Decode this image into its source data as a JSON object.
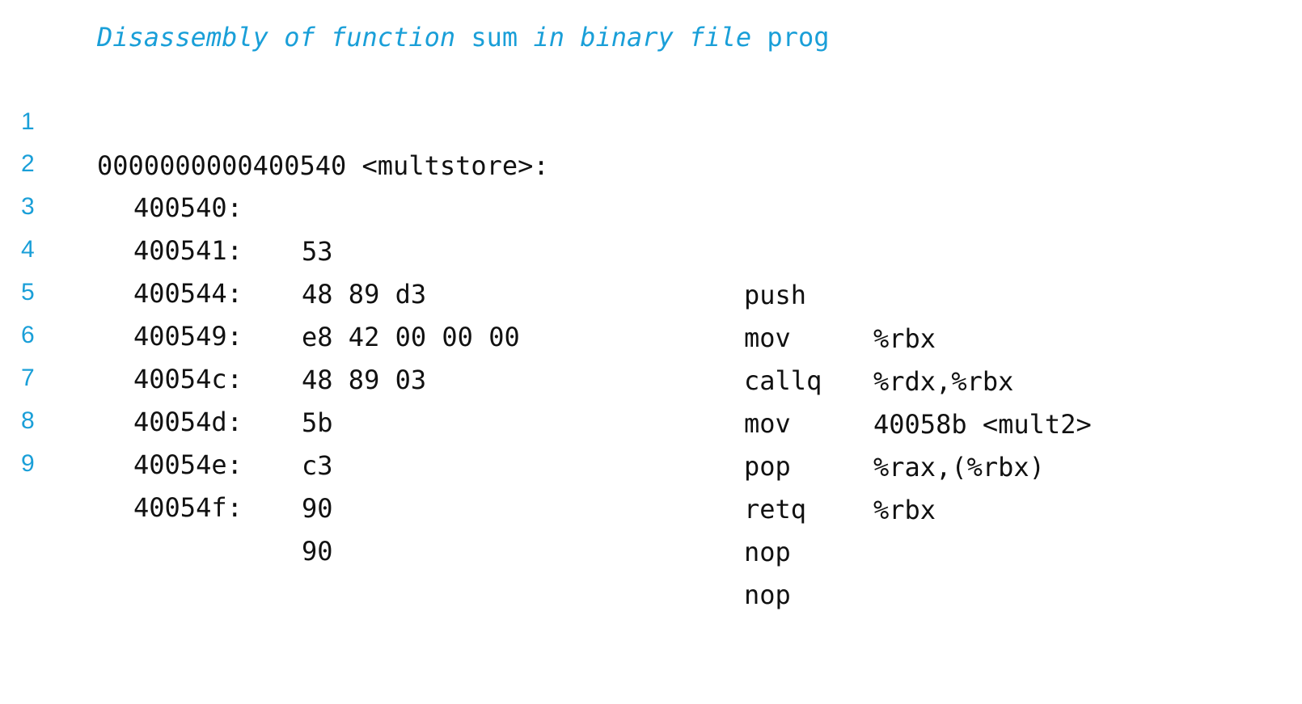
{
  "caption": {
    "part1": "Disassembly of function ",
    "part2": "sum",
    "part3": " in binary file ",
    "part4": "prog"
  },
  "header": {
    "number": "1",
    "text": "0000000000400540 <multstore>:"
  },
  "lines": [
    {
      "number": "2",
      "addr": "400540:",
      "bytes": "53",
      "op": "push",
      "args": "%rbx"
    },
    {
      "number": "3",
      "addr": "400541:",
      "bytes": "48 89 d3",
      "op": "mov",
      "args": "%rdx,%rbx"
    },
    {
      "number": "4",
      "addr": "400544:",
      "bytes": "e8 42 00 00 00",
      "op": "callq",
      "args": "40058b <mult2>"
    },
    {
      "number": "5",
      "addr": "400549:",
      "bytes": "48 89 03",
      "op": "mov",
      "args": "%rax,(%rbx)"
    },
    {
      "number": "6",
      "addr": "40054c:",
      "bytes": "5b",
      "op": "pop",
      "args": "%rbx"
    },
    {
      "number": "7",
      "addr": "40054d:",
      "bytes": "c3",
      "op": "retq",
      "args": ""
    },
    {
      "number": "8",
      "addr": "40054e:",
      "bytes": "90",
      "op": "nop",
      "args": ""
    },
    {
      "number": "9",
      "addr": "40054f:",
      "bytes": "90",
      "op": "nop",
      "args": ""
    }
  ],
  "colors": {
    "accent": "#1a9fd8",
    "text": "#111111",
    "background": "#ffffff"
  }
}
